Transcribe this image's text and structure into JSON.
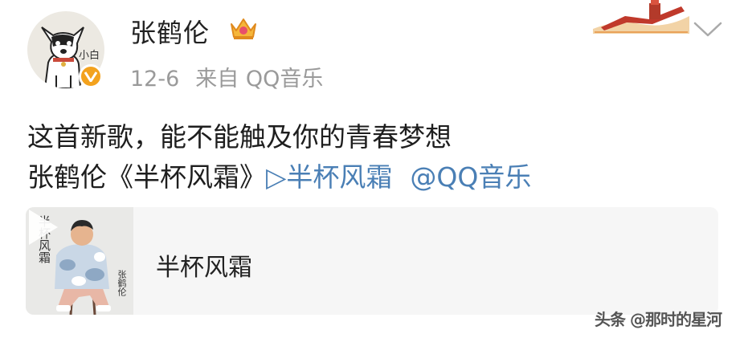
{
  "post": {
    "author": {
      "name": "张鹤伦",
      "avatar_label": "小白",
      "verified_color": "#f3a21e"
    },
    "meta": {
      "date": "12-6",
      "source": "来自 QQ音乐"
    },
    "content": {
      "line1": "这首新歌，能不能触及你的青春梦想",
      "line2_prefix": "张鹤伦《半杯风霜》",
      "song_link": "▷半杯风霜",
      "mention": "@QQ音乐"
    },
    "card": {
      "title": "半杯风霜",
      "cover_title": "半杯风霜",
      "cover_artist": "张鹤伦"
    },
    "watermark": "头条 @那时的星河",
    "colors": {
      "link": "#4a7fb5",
      "text": "#1e1e1e",
      "meta": "#9a9a9a"
    },
    "icons": [
      "crown-icon",
      "verified-icon",
      "chevron-down-icon",
      "play-icon"
    ]
  }
}
